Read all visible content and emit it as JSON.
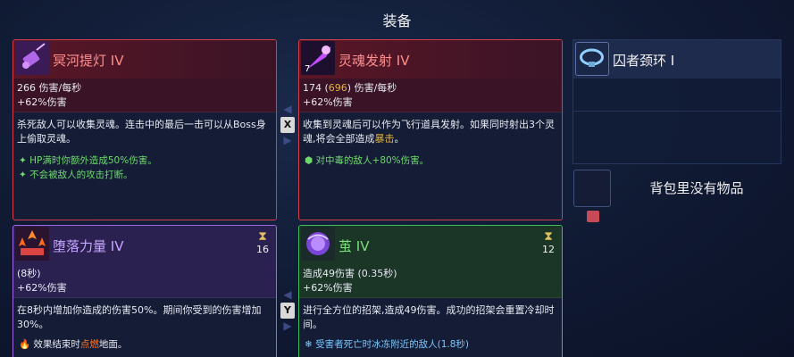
{
  "title": "装备",
  "cards": [
    {
      "name": "冥河提灯 IV",
      "stats_line1": "266 伤害/每秒",
      "stats_line2": "+62%伤害",
      "desc": "杀死敌人可以收集灵魂。连击中的最后一击可以从Boss身上偷取灵魂。",
      "perks": [
        "HP满时你额外造成50%伤害。",
        "不会被敌人的攻击打断。"
      ]
    },
    {
      "name": "灵魂发射 IV",
      "icon_count": "7",
      "stats_pre": "174 (",
      "stats_hl": "696",
      "stats_post": ") 伤害/每秒",
      "stats_line2": "+62%伤害",
      "desc_pre": "收集到灵魂后可以作为飞行道具发射。如果同时射出3个灵魂,将会全部造成",
      "desc_hl": "暴击",
      "desc_post": "。",
      "perks": [
        "对中毒的敌人+80%伤害。"
      ]
    },
    {
      "name": "堕落力量 IV",
      "timer": "16",
      "stats_line1": "(8秒)",
      "stats_line2": "+62%伤害",
      "desc": "在8秒内增加你造成的伤害50%。期间你受到的伤害增加30%。",
      "perk_pre": "效果结束时",
      "perk_hl": "点燃",
      "perk_post": "地面。"
    },
    {
      "name": "茧 IV",
      "timer": "12",
      "stats_line1": "造成49伤害 (0.35秒)",
      "stats_line2": "+62%伤害",
      "desc": "进行全方位的招架,造成49伤害。成功的招架会重置冷却时间。",
      "perk": "受害者死亡时冰冻附近的敌人(1.8秒)"
    }
  ],
  "swap_keys": [
    "X",
    "Y"
  ],
  "amulet": {
    "name": "囚者颈环 I"
  },
  "backpack": {
    "empty_text": "背包里没有物品"
  },
  "colors": {
    "red": "#d2404c",
    "green": "#3dbe5a",
    "purple": "#9d67e6",
    "highlight": "#e4b43a"
  }
}
